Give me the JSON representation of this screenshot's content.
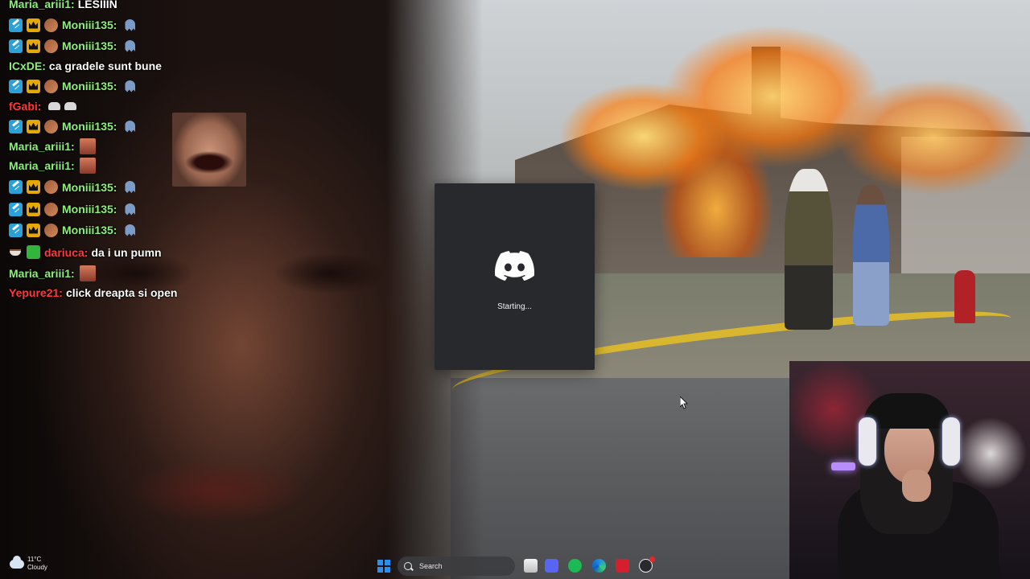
{
  "chat": {
    "messages": [
      {
        "username": "Maria_ariii1:",
        "text": "LESIIIN"
      },
      {
        "username": "Moniii135:",
        "text": ""
      },
      {
        "username": "Moniii135:",
        "text": ""
      },
      {
        "username": "ICxDE:",
        "text": "ca gradele sunt bune"
      },
      {
        "username": "Moniii135:",
        "text": ""
      },
      {
        "username": "fGabi:",
        "text": ""
      },
      {
        "username": "Moniii135:",
        "text": ""
      },
      {
        "username": "Maria_ariii1:",
        "text": ""
      },
      {
        "username": "Maria_ariii1:",
        "text": ""
      },
      {
        "username": "Moniii135:",
        "text": ""
      },
      {
        "username": "Moniii135:",
        "text": ""
      },
      {
        "username": "Moniii135:",
        "text": ""
      },
      {
        "username": "dariuca:",
        "text": "da i un pumn"
      },
      {
        "username": "Maria_ariii1:",
        "text": ""
      },
      {
        "username": "Yepure21:",
        "text": "click dreapta si open"
      }
    ]
  },
  "discord_splash": {
    "status": "Starting...",
    "brand_color": "#5865f2",
    "background": "#27292d"
  },
  "taskbar": {
    "weather": {
      "temperature": "11°C",
      "condition": "Cloudy"
    },
    "search_placeholder": "Search",
    "pinned": [
      "windows-start-icon",
      "file-explorer-icon",
      "discord-icon",
      "spotify-icon",
      "edge-icon",
      "red-app-icon",
      "obs-icon"
    ]
  }
}
